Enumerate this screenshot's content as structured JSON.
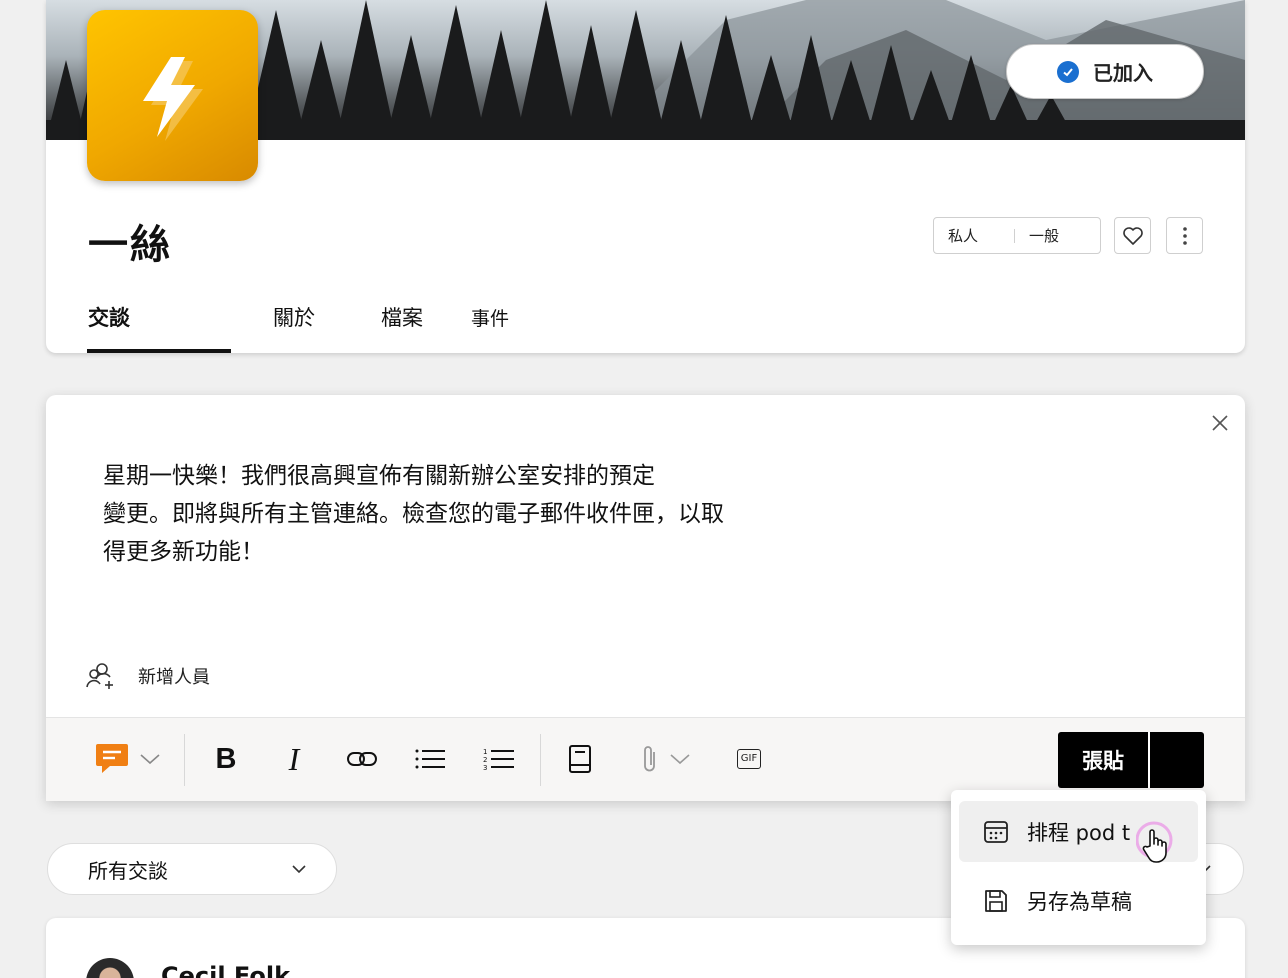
{
  "header": {
    "joined_label": "已加入",
    "title": "一絲",
    "privacy": {
      "type": "私人",
      "category": "一般"
    },
    "tabs": [
      {
        "label": "交談",
        "active": true
      },
      {
        "label": "關於",
        "active": false
      },
      {
        "label": "檔案",
        "active": false
      },
      {
        "label": "事件",
        "active": false
      }
    ]
  },
  "composer": {
    "message_lines": [
      "星期一快樂！我們很高興宣佈有關新辦公室安排的預定",
      "變更。即將與所有主管連絡。檢查您的電子郵件收件匣，以取",
      "得更多新功能！"
    ],
    "add_people": "新增人員",
    "toolbar": {
      "post_label": "張貼",
      "gif_label": "GIF",
      "icons": [
        "praise-icon",
        "bold-icon",
        "italic-icon",
        "link-icon",
        "bulleted-list-icon",
        "numbered-list-icon",
        "book-icon",
        "attach-icon",
        "gif-icon"
      ]
    }
  },
  "post_menu": {
    "items": [
      {
        "label": "排程 pod t",
        "icon": "calendar-icon"
      },
      {
        "label": "另存為草稿",
        "icon": "save-icon"
      }
    ]
  },
  "filter": {
    "label": "所有交談"
  },
  "post": {
    "author": "Cecil Folk"
  },
  "colors": {
    "accent_yellow": "#f0a800",
    "post_button": "#000000",
    "check_blue": "#1a6fd0",
    "praise_orange": "#f07f13"
  }
}
